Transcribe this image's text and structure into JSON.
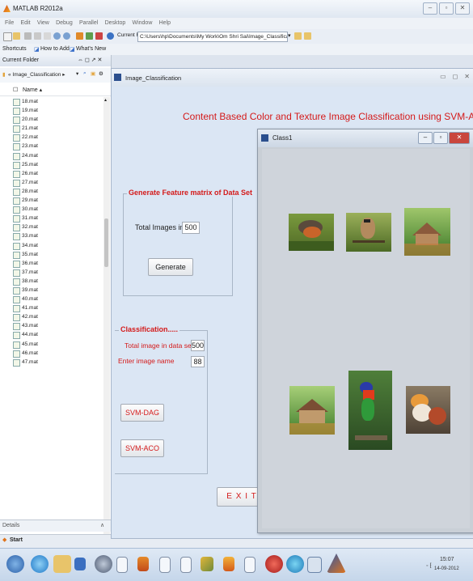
{
  "app": {
    "title": "MATLAB R2012a",
    "menu": [
      "File",
      "Edit",
      "View",
      "Debug",
      "Parallel",
      "Desktop",
      "Window",
      "Help"
    ],
    "current_folder_label": "Current Folder:",
    "current_folder_path": "C:\\Users\\hp\\Documents\\My Work\\Om Shri Sai\\Image_Classification",
    "shortcuts": [
      "Shortcuts",
      "How to Add",
      "What's New"
    ]
  },
  "left_panel": {
    "title": "Current Folder",
    "path": "« Image_Classification ▸",
    "name_header": "Name ▴",
    "files": [
      "18.mat",
      "19.mat",
      "20.mat",
      "21.mat",
      "22.mat",
      "23.mat",
      "24.mat",
      "25.mat",
      "26.mat",
      "27.mat",
      "28.mat",
      "29.mat",
      "30.mat",
      "31.mat",
      "32.mat",
      "33.mat",
      "34.mat",
      "35.mat",
      "36.mat",
      "37.mat",
      "38.mat",
      "39.mat",
      "40.mat",
      "41.mat",
      "42.mat",
      "43.mat",
      "44.mat",
      "45.mat",
      "46.mat",
      "47.mat"
    ],
    "details_label": "Details",
    "start_label": "Start"
  },
  "gui": {
    "window_title": "Image_Classification",
    "main_title": "Content Based Color and Texture Image Classification using SVM-ACO",
    "feature_panel_title": "Generate Feature matrix of Data Set",
    "total_images_label": "Total Images in",
    "total_images_value": "500",
    "generate_button": "Generate",
    "classification_panel_title": "Classification.....",
    "total_image_dataset_label": "Total image in data set",
    "total_image_dataset_value": "500",
    "enter_image_label": "Enter image name",
    "enter_image_value": "88",
    "svm_dag_button": "SVM-DAG",
    "svm_aco_button": "SVM-ACO",
    "exit_button": "E X I T"
  },
  "class_window": {
    "title": "Class1",
    "images": [
      "robin-bird",
      "waxwing-bird",
      "garden-house",
      "garden-house-2",
      "rainbow-lorikeet",
      "mandarin-ducks"
    ]
  },
  "taskbar": {
    "time": "15:07",
    "date": "14-09-2012"
  },
  "colors": {
    "title_red": "#d41a1a",
    "gui_bg": "#dbe6f4"
  }
}
